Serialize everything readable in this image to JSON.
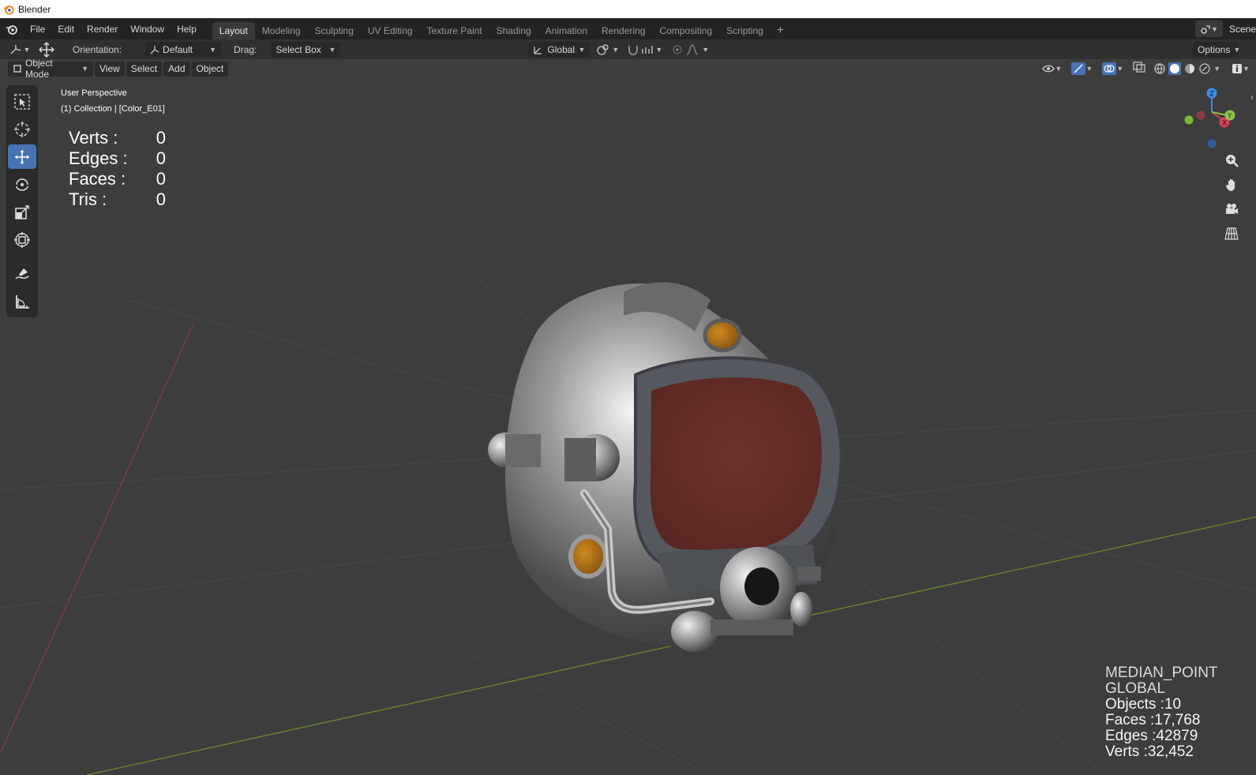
{
  "window": {
    "title": "Blender"
  },
  "menu": {
    "file": "File",
    "edit": "Edit",
    "render": "Render",
    "window": "Window",
    "help": "Help"
  },
  "workspaces": [
    "Layout",
    "Modeling",
    "Sculpting",
    "UV Editing",
    "Texture Paint",
    "Shading",
    "Animation",
    "Rendering",
    "Compositing",
    "Scripting"
  ],
  "workspace_add": "+",
  "scene": {
    "label": "Scene"
  },
  "toolheader": {
    "orientation_label": "Orientation:",
    "orientation_value": "Default",
    "drag_label": "Drag:",
    "drag_value": "Select Box",
    "transform_orientation": "Global",
    "options": "Options"
  },
  "viewport_header": {
    "mode": "Object Mode",
    "view": "View",
    "select": "Select",
    "add": "Add",
    "object": "Object"
  },
  "overlay": {
    "perspective": "User Perspective",
    "collection": "(1) Collection | [Color_E01]"
  },
  "stats": [
    {
      "key": "Verts :",
      "value": "0"
    },
    {
      "key": "Edges :",
      "value": "0"
    },
    {
      "key": "Faces :",
      "value": "0"
    },
    {
      "key": "Tris :",
      "value": "0"
    }
  ],
  "bottom_right": {
    "pivot": "MEDIAN_POINT",
    "orientation": "GLOBAL",
    "objects": "Objects :10",
    "faces": "Faces :17,768",
    "edges": "Edges :42879",
    "verts": "Verts :32,452"
  },
  "gizmo": {
    "z": "Z",
    "x": "X",
    "y": "Y"
  },
  "colors": {
    "accent": "#4772b3",
    "axis_x": "#d9404d",
    "axis_y": "#8bc34a",
    "axis_z": "#3d8fe6",
    "visor": "#6b2f28"
  },
  "tools": [
    "select-box-icon",
    "cursor-icon",
    "move-icon",
    "rotate-icon",
    "scale-icon",
    "transform-icon",
    "annotate-icon",
    "measure-icon"
  ]
}
